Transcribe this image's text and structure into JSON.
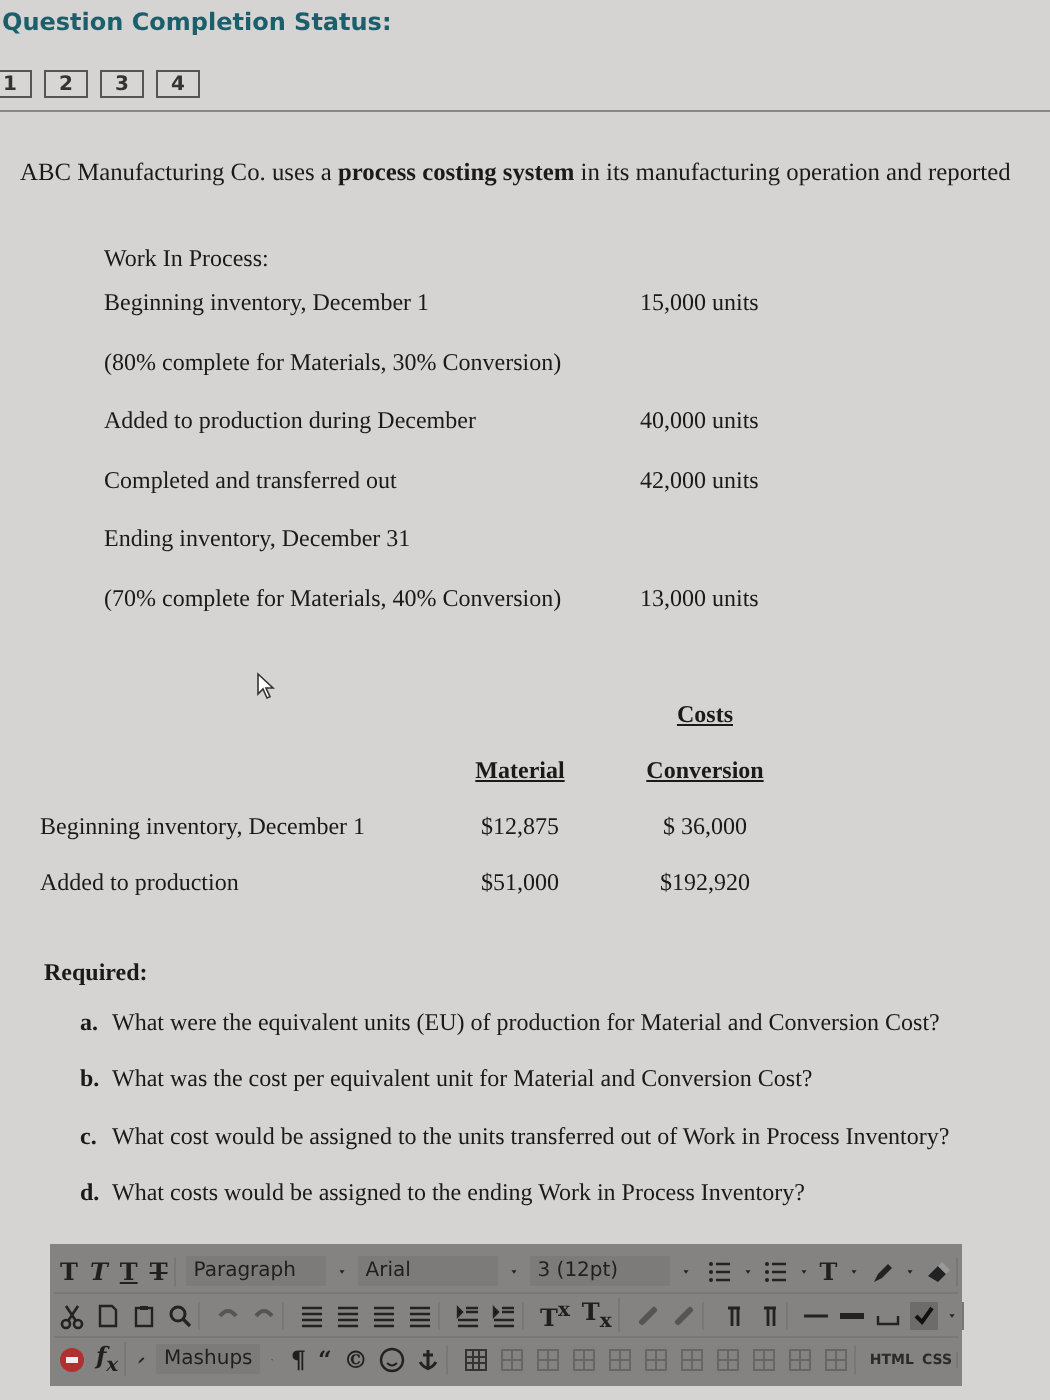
{
  "status": {
    "title": "Question Completion Status:",
    "questions": [
      "1",
      "2",
      "3",
      "4"
    ]
  },
  "intro": "ABC Manufacturing Co. uses a **process costing system** in its manufacturing operation and reported",
  "work_in_process": {
    "heading": "Work In Process:",
    "rows": [
      {
        "label": "Beginning inventory, December 1",
        "value": "15,000  units"
      },
      {
        "label": "(80% complete for Materials, 30% Conversion)",
        "value": ""
      },
      {
        "label": "Added to production during December",
        "value": "40,000  units"
      },
      {
        "label": "Completed and transferred out",
        "value": "42,000  units"
      },
      {
        "label": "Ending inventory, December 31",
        "value": ""
      },
      {
        "label": "(70% complete for Materials, 40% Conversion)",
        "value": "13,000 units"
      }
    ]
  },
  "costs": {
    "group_heading": "Costs",
    "columns": [
      "Material",
      "Conversion"
    ],
    "rows": [
      {
        "label": "Beginning inventory, December 1",
        "material": "$12,875",
        "conversion": "$  36,000"
      },
      {
        "label": "Added to production",
        "material": "$51,000",
        "conversion": "$192,920"
      }
    ]
  },
  "required": {
    "heading": "Required:",
    "items": [
      {
        "letter": "a.",
        "text": "What were the equivalent units (EU) of production for Material and Conversion Cost?"
      },
      {
        "letter": "b.",
        "text": "What was the cost per equivalent unit for Material and Conversion Cost?"
      },
      {
        "letter": "c.",
        "text": "What cost would be assigned to the units transferred out of Work in Process Inventory?"
      },
      {
        "letter": "d.",
        "text": "What costs would be assigned to the ending Work in Process Inventory?"
      }
    ]
  },
  "editor_toolbar": {
    "style_buttons": [
      "T",
      "T",
      "T",
      "T"
    ],
    "dropdowns": [
      "Paragraph",
      "Arial",
      "3 (12pt)"
    ],
    "font_color_button": "T",
    "script_buttons": [
      "T$^{x}$",
      "T$_{x}$"
    ],
    "formula_button": "f$_{x}$",
    "mashups": "Mashups",
    "symbol_buttons": [
      "¶",
      "“",
      "©"
    ],
    "source_buttons": [
      "HTML",
      "CSS"
    ]
  }
}
